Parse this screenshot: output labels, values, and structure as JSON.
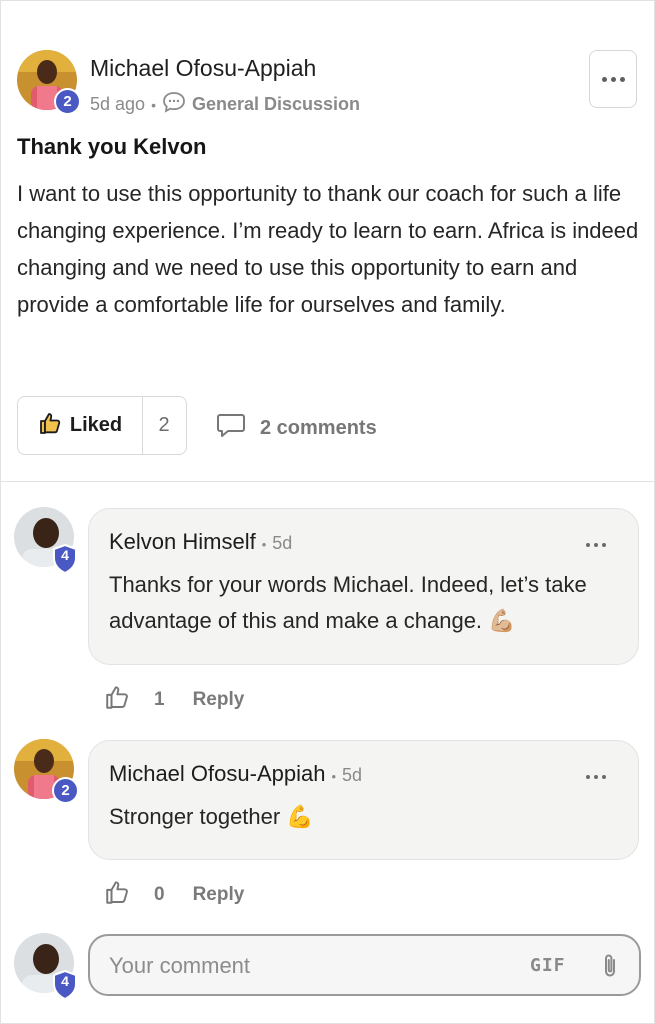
{
  "post": {
    "author": "Michael Ofosu-Appiah",
    "author_level": "2",
    "time": "5d ago",
    "separator": "•",
    "category": "General Discussion",
    "title": "Thank you Kelvon",
    "body": "I want to use this opportunity to thank our coach for such a life changing experience. I’m ready to learn to earn. Africa is indeed changing and we need to use this opportunity to earn and provide a comfortable life for ourselves and family.",
    "liked_label": "Liked",
    "like_count": "2",
    "comments_label": "2 comments"
  },
  "comments": [
    {
      "author": "Kelvon Himself",
      "level": "4",
      "separator": "•",
      "time": "5d",
      "text": "Thanks for your words Michael. Indeed, let’s take advantage of this and make a change. 💪🏼",
      "likes": "1",
      "reply_label": "Reply"
    },
    {
      "author": "Michael Ofosu-Appiah",
      "level": "2",
      "separator": "•",
      "time": "5d",
      "text": "Stronger together 💪",
      "likes": "0",
      "reply_label": "Reply"
    }
  ],
  "composer": {
    "user_level": "4",
    "placeholder": "Your comment",
    "gif_label": "GIF"
  },
  "colors": {
    "level_badge": "#4a58c4",
    "text_primary": "#1d1d1f",
    "text_muted": "#8a8a8a"
  },
  "icons": {
    "more": "more-horizontal-icon",
    "category": "chat-bubble-icon",
    "like": "thumbs-up-icon",
    "comment": "comment-icon",
    "attach": "paperclip-icon"
  }
}
